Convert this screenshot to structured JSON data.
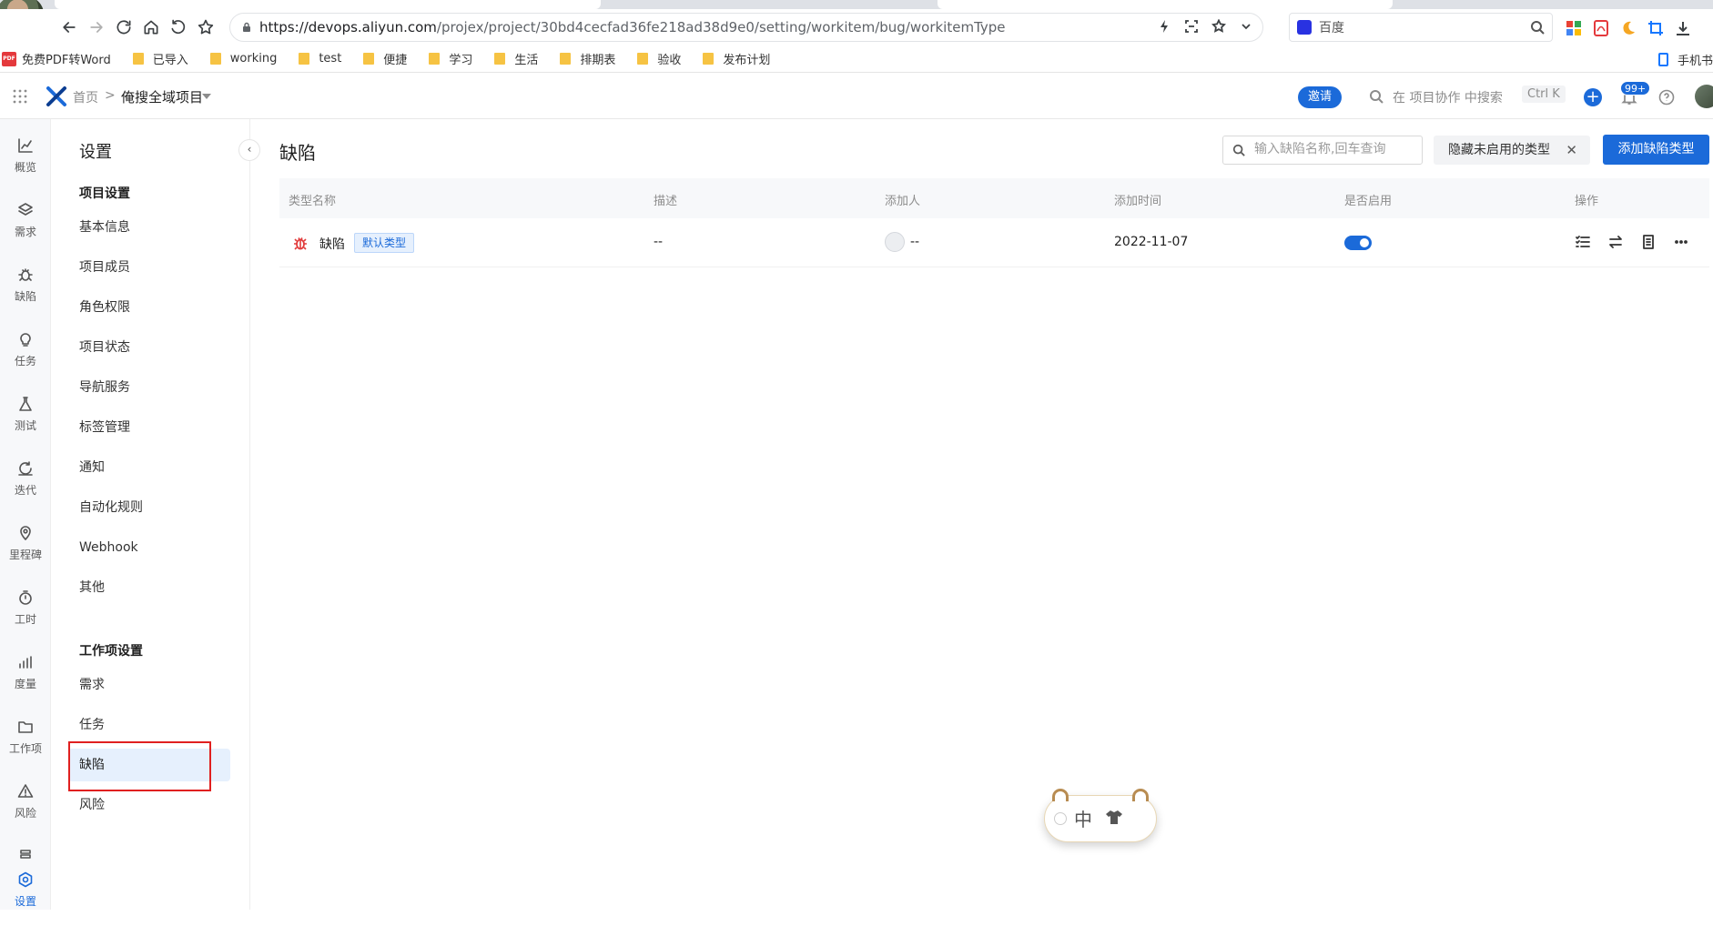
{
  "browser": {
    "url_main": "https://devops.aliyun.com",
    "url_path": "/projex/project/30bd4cecfad36fe218ad38d9e0/setting/workitem/bug/workitemType",
    "search_engine_label": "百度",
    "bookmarks": [
      "免费PDF转Word",
      "已导入",
      "working",
      "test",
      "便捷",
      "学习",
      "生活",
      "排期表",
      "验收",
      "发布计划"
    ],
    "mobile_bookmark": "手机书"
  },
  "header": {
    "home": "首页",
    "separator": ">",
    "project": "俺搜全域项目",
    "invite": "邀请",
    "search_placeholder": "在 项目协作 中搜索",
    "shortcut": "Ctrl K",
    "notification_badge": "99+"
  },
  "rail": {
    "items": [
      {
        "label": "概览",
        "icon": "chart-line-icon"
      },
      {
        "label": "需求",
        "icon": "layers-icon"
      },
      {
        "label": "缺陷",
        "icon": "bug-icon"
      },
      {
        "label": "任务",
        "icon": "bulb-icon"
      },
      {
        "label": "测试",
        "icon": "flask-icon"
      },
      {
        "label": "迭代",
        "icon": "cycle-icon"
      },
      {
        "label": "里程碑",
        "icon": "location-pin-icon"
      },
      {
        "label": "工时",
        "icon": "stopwatch-icon"
      },
      {
        "label": "度量",
        "icon": "bar-chart-icon"
      },
      {
        "label": "工作项",
        "icon": "folder-icon"
      },
      {
        "label": "风险",
        "icon": "warning-icon"
      },
      {
        "label": "设置",
        "icon": "settings-icon"
      }
    ]
  },
  "sidebar": {
    "title": "设置",
    "group1": "项目设置",
    "project_items": [
      "基本信息",
      "项目成员",
      "角色权限",
      "项目状态",
      "导航服务",
      "标签管理",
      "通知",
      "自动化规则",
      "Webhook",
      "其他"
    ],
    "group2": "工作项设置",
    "workitem_items": [
      "需求",
      "任务",
      "缺陷",
      "风险"
    ],
    "active_item": "缺陷"
  },
  "main": {
    "title": "缺陷",
    "search_placeholder": "输入缺陷名称,回车查询",
    "filter_label": "隐藏未启用的类型",
    "add_button": "添加缺陷类型",
    "columns": [
      "类型名称",
      "描述",
      "添加人",
      "添加时间",
      "是否启用",
      "操作"
    ],
    "rows": [
      {
        "name": "缺陷",
        "tag": "默认类型",
        "description": "--",
        "creator": "--",
        "created_at": "2022-11-07",
        "enabled": true
      }
    ]
  },
  "ime": {
    "char": "中"
  },
  "colors": {
    "accent": "#1b6ad9",
    "highlight_box": "#e02020",
    "bug_red": "#e23b3b"
  }
}
